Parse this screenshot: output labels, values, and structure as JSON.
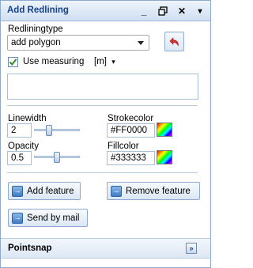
{
  "window": {
    "title": "Add Redlining",
    "minimize_glyph": "_",
    "restore_glyph": "🗗",
    "close_glyph": "✕",
    "menu_glyph": "▾"
  },
  "redlining": {
    "type_label": "Redliningtype",
    "type_value": "add polygon",
    "undo_icon": "undo-arrow-icon"
  },
  "measuring": {
    "checked": true,
    "label": "Use measuring",
    "unit": "[m]",
    "unit_glyph": "▾"
  },
  "style": {
    "linewidth_label": "Linewidth",
    "linewidth_value": "2",
    "linewidth_slider_fraction": 0.3,
    "opacity_label": "Opacity",
    "opacity_value": "0.5",
    "opacity_slider_fraction": 0.5,
    "strokecolor_label": "Strokecolor",
    "strokecolor_value": "#FF0000",
    "fillcolor_label": "Fillcolor",
    "fillcolor_value": "#333333"
  },
  "actions": {
    "add_feature": "Add feature",
    "remove_feature": "Remove feature",
    "send_by_mail": "Send by mail",
    "button_icon_glyph": "→"
  },
  "footer": {
    "label": "Pointsnap",
    "expand_glyph": "»"
  },
  "colors": {
    "header_text": "#15428b",
    "border": "#8eaad2",
    "undo_arrow": "#d83030",
    "check": "#2a8a2a"
  }
}
